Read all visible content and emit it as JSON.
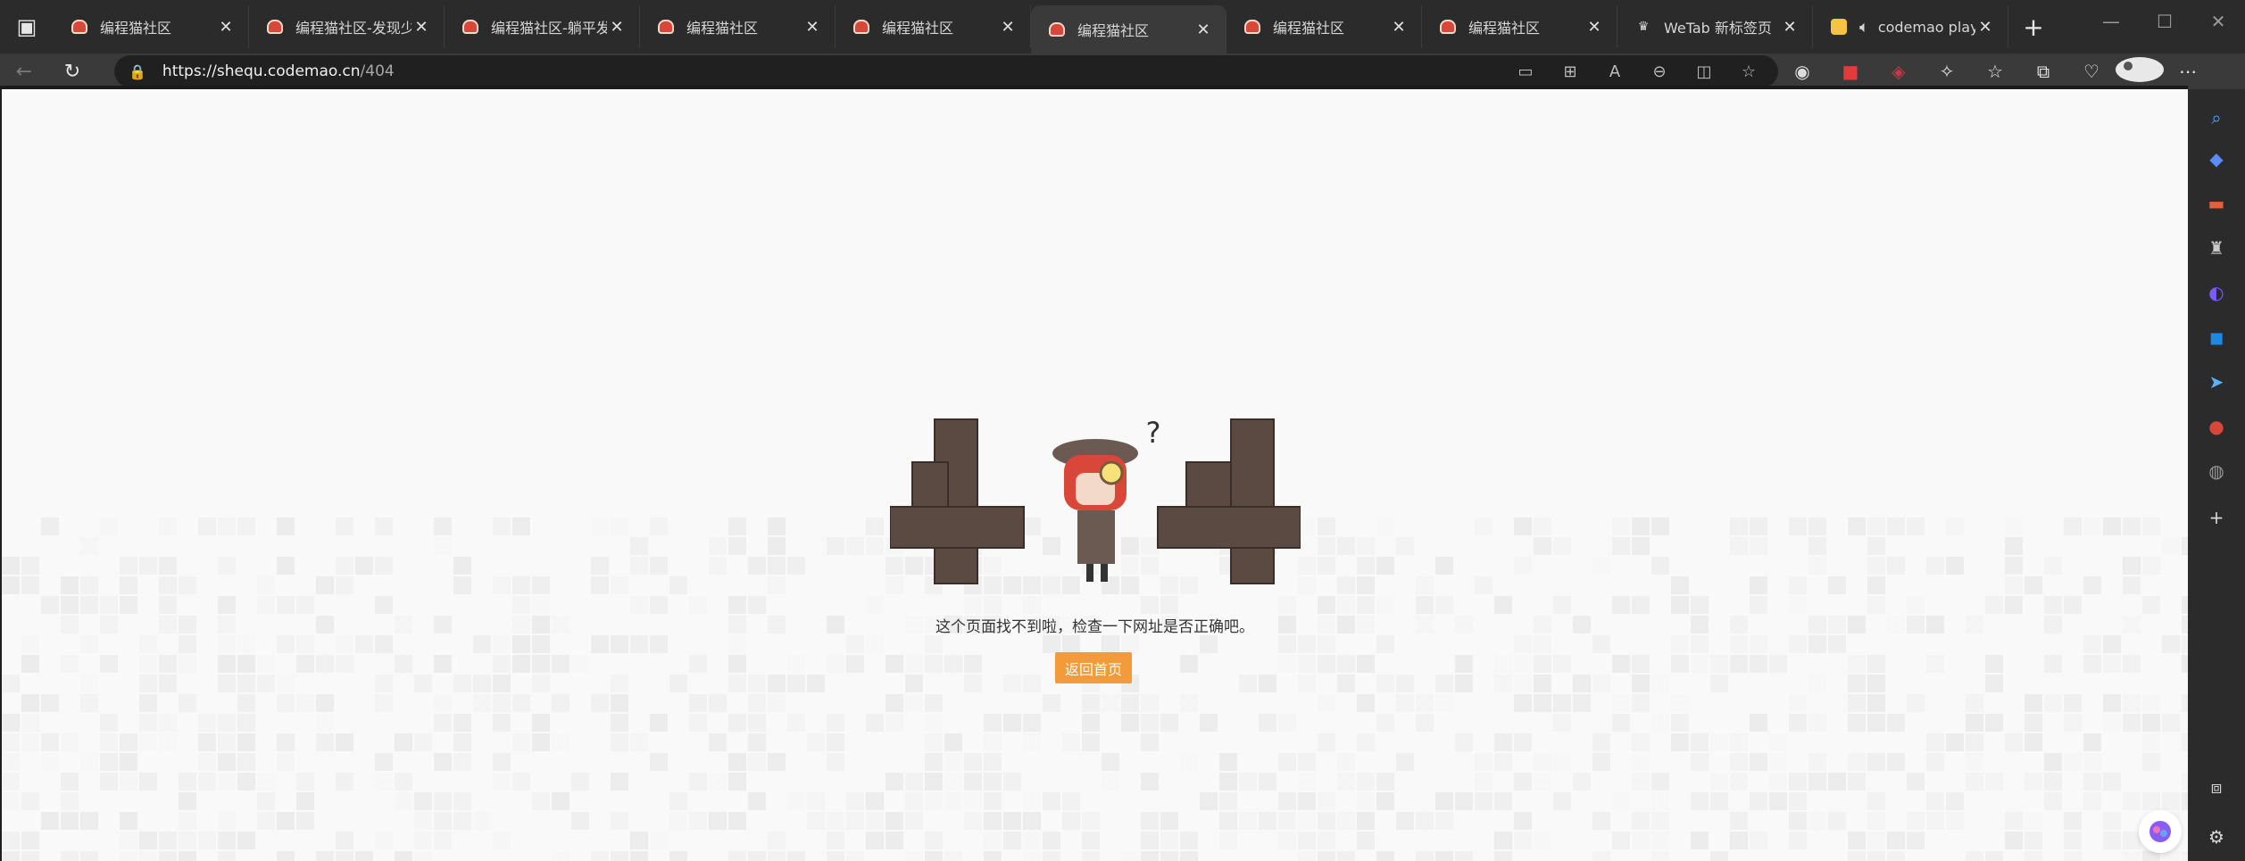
{
  "tabs": [
    {
      "title": "编程猫社区",
      "active": false,
      "audio": false
    },
    {
      "title": "编程猫社区-发现少儿",
      "active": false,
      "audio": false
    },
    {
      "title": "编程猫社区-躺平发篇",
      "active": false,
      "audio": false
    },
    {
      "title": "编程猫社区",
      "active": false,
      "audio": false
    },
    {
      "title": "编程猫社区",
      "active": false,
      "audio": false
    },
    {
      "title": "编程猫社区",
      "active": true,
      "audio": false
    },
    {
      "title": "编程猫社区",
      "active": false,
      "audio": false
    },
    {
      "title": "编程猫社区",
      "active": false,
      "audio": false
    },
    {
      "title": "WeTab 新标签页",
      "active": false,
      "audio": false
    },
    {
      "title": "codemao player",
      "active": false,
      "audio": true
    }
  ],
  "address": {
    "host": "https://shequ.codemao.cn",
    "path": "/404"
  },
  "page": {
    "error_code_digits": [
      "4",
      "4"
    ],
    "message": "这个页面找不到啦，检查一下网址是否正确吧。",
    "home_button": "返回首页",
    "question_mark": "?"
  },
  "colors": {
    "accent_button": "#f39a3a",
    "brick": "#5a4a42",
    "page_bg": "#f9f9fa"
  },
  "icons": {
    "sidebar": [
      "search-icon",
      "tag-icon",
      "briefcase-icon",
      "games-icon",
      "copilot-icon",
      "outlook-icon",
      "send-icon",
      "codemao-icon",
      "extension-icon",
      "add-icon",
      "screenshot-icon",
      "settings-icon"
    ]
  }
}
